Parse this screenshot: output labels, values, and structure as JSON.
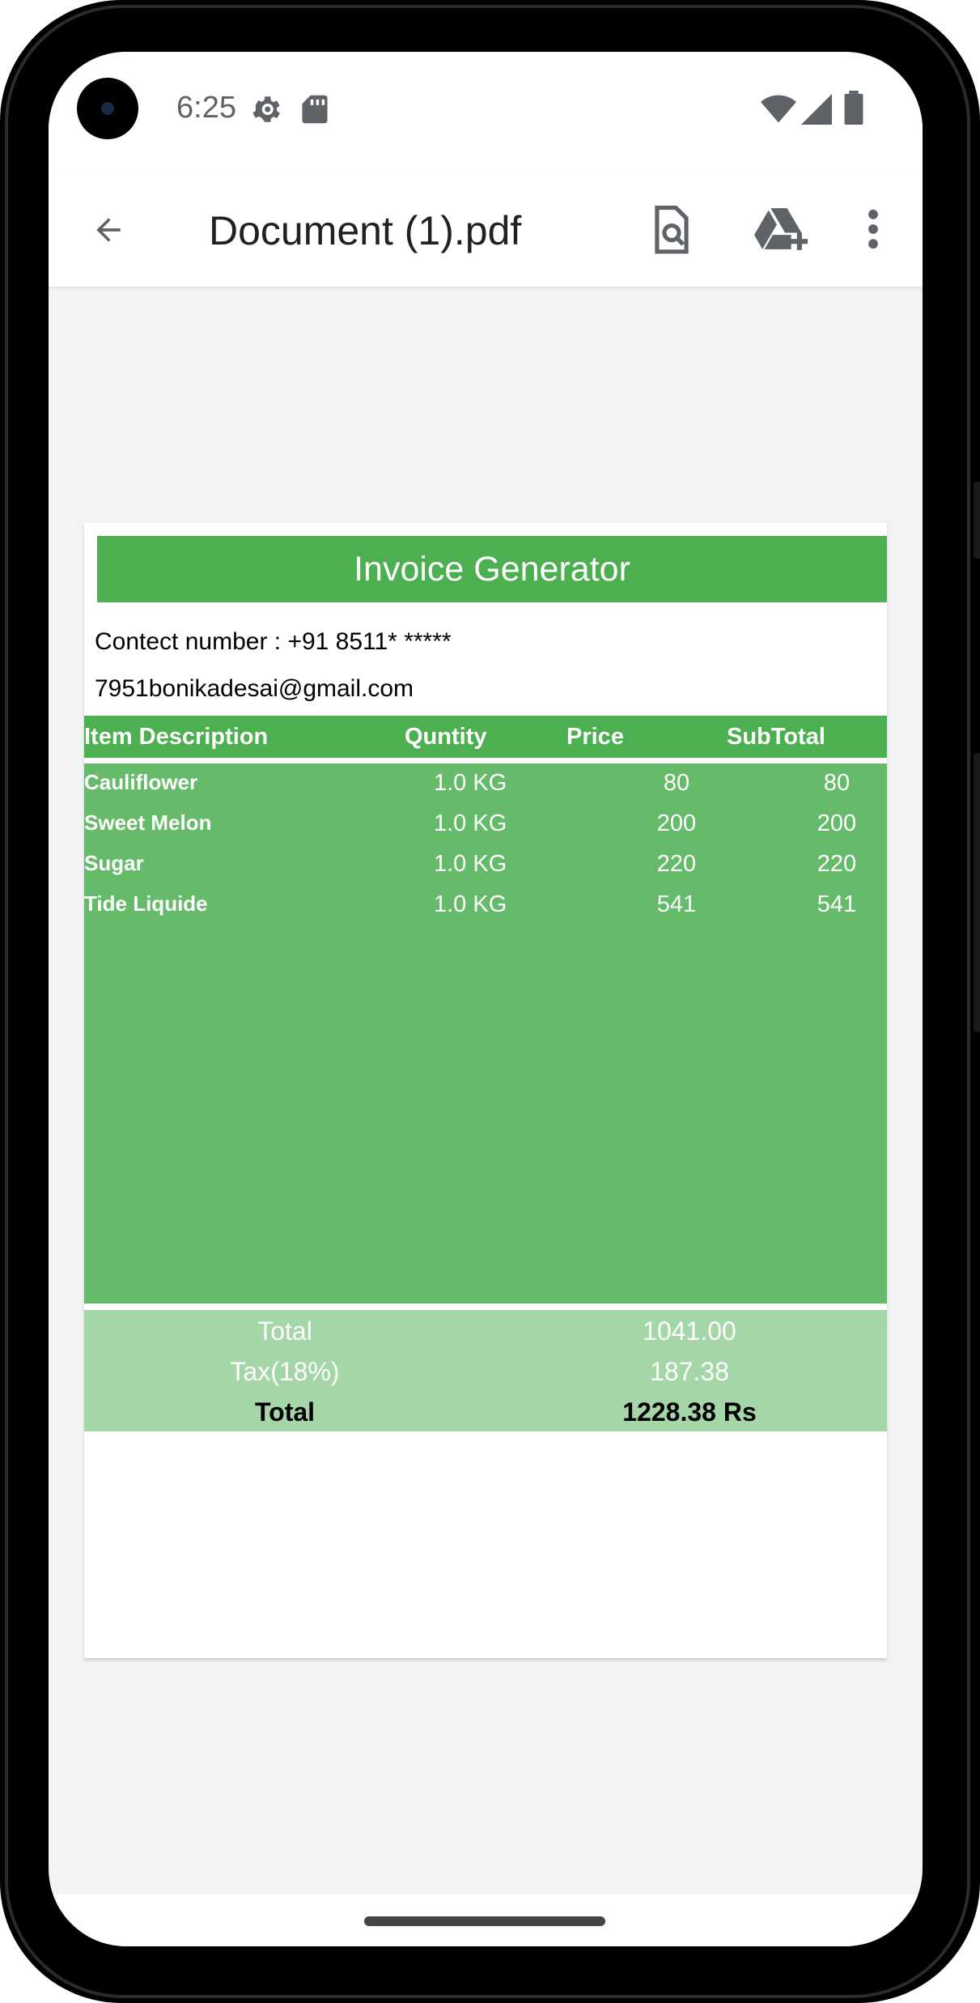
{
  "status_bar": {
    "time": "6:25",
    "icons": [
      "settings-icon",
      "sd-card-icon",
      "wifi-icon",
      "cell-signal-icon",
      "battery-icon"
    ]
  },
  "app_bar": {
    "title": "Document (1).pdf",
    "icons": [
      "back-arrow-icon",
      "search-document-icon",
      "drive-add-icon",
      "more-vert-icon"
    ]
  },
  "invoice": {
    "header": "Invoice Generator",
    "contact": "Contect number : +91 8511* *****",
    "email": "7951bonikadesai@gmail.com",
    "columns": [
      "Item Description",
      "Quntity",
      "Price",
      "SubTotal"
    ],
    "rows": [
      {
        "desc": "Cauliflower",
        "qty": "1.0 KG",
        "price": "80",
        "sub": "80"
      },
      {
        "desc": "Sweet Melon",
        "qty": "1.0 KG",
        "price": "200",
        "sub": "200"
      },
      {
        "desc": "Sugar",
        "qty": "1.0 KG",
        "price": "220",
        "sub": "220"
      },
      {
        "desc": "Tide Liquide",
        "qty": "1.0 KG",
        "price": "541",
        "sub": "541"
      }
    ],
    "totals": {
      "total_label": "Total",
      "total_value": "1041.00",
      "tax_label": "Tax(18%)",
      "tax_value": "187.38",
      "grand_label": "Total",
      "grand_value": "1228.38 Rs"
    }
  },
  "colors": {
    "header_green": "#4caf50",
    "body_green": "#66bb6a",
    "totals_green": "#a5d6a7",
    "viewer_background": "#f1f3f4"
  }
}
